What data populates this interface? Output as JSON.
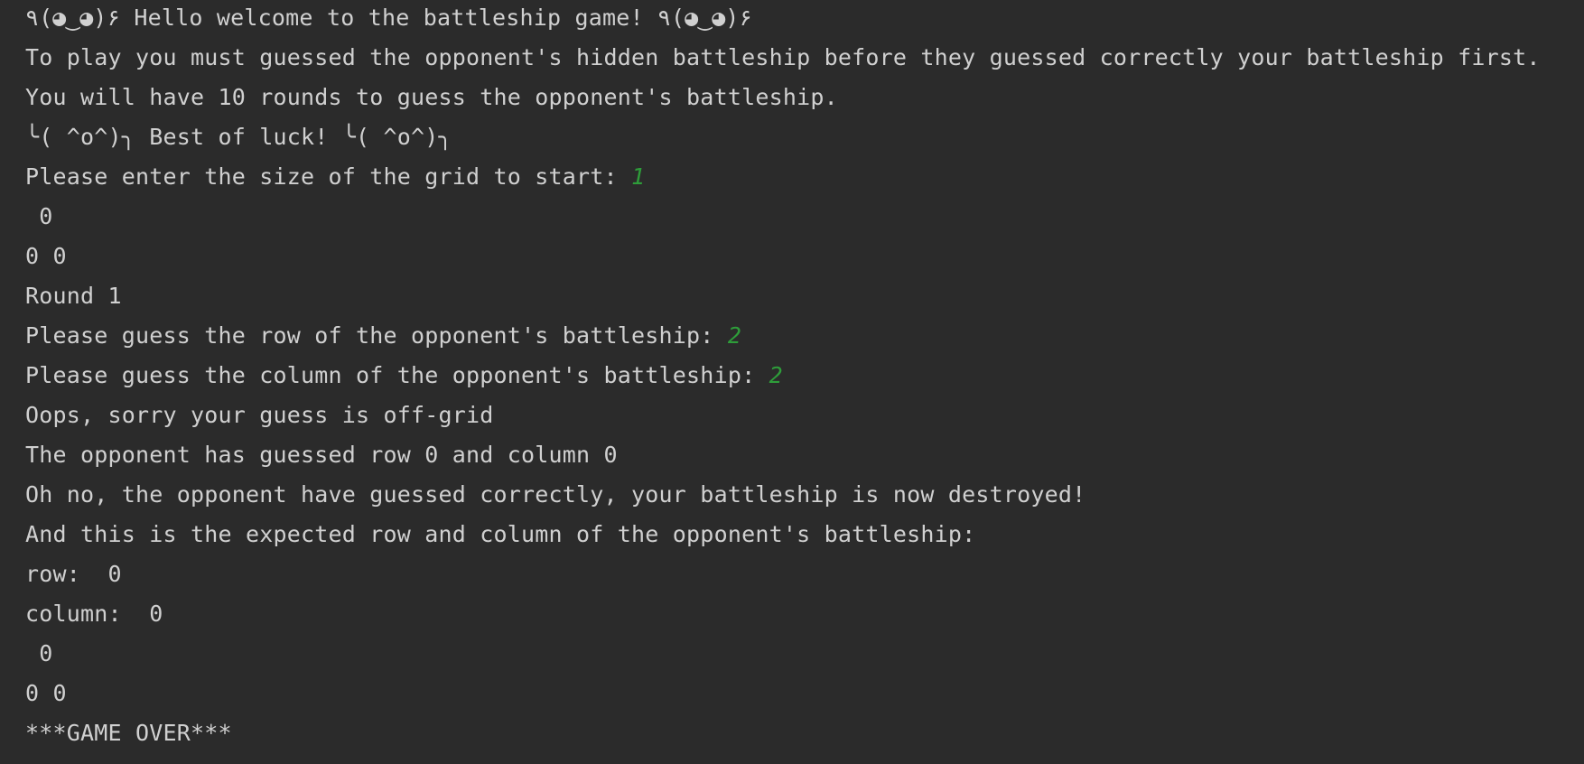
{
  "colors": {
    "background": "#2b2b2b",
    "text": "#d0d0d0",
    "user_input": "#2e9d3a"
  },
  "console": {
    "lines": [
      {
        "text": "٩(◕‿◕)۶ Hello welcome to the battleship game! ٩(◕‿◕)۶",
        "input": ""
      },
      {
        "text": "To play you must guessed the opponent's hidden battleship before they guessed correctly your battleship first.",
        "input": ""
      },
      {
        "text": "You will have 10 rounds to guess the opponent's battleship.",
        "input": ""
      },
      {
        "text": "╰( ^o^)╮ Best of luck! ╰( ^o^)╮",
        "input": ""
      },
      {
        "text": "Please enter the size of the grid to start: ",
        "input": "1"
      },
      {
        "text": " 0",
        "input": ""
      },
      {
        "text": "0 0",
        "input": ""
      },
      {
        "text": "Round 1",
        "input": ""
      },
      {
        "text": "Please guess the row of the opponent's battleship: ",
        "input": "2"
      },
      {
        "text": "Please guess the column of the opponent's battleship: ",
        "input": "2"
      },
      {
        "text": "Oops, sorry your guess is off-grid",
        "input": ""
      },
      {
        "text": "The opponent has guessed row 0 and column 0",
        "input": ""
      },
      {
        "text": "Oh no, the opponent have guessed correctly, your battleship is now destroyed!",
        "input": ""
      },
      {
        "text": "And this is the expected row and column of the opponent's battleship:",
        "input": ""
      },
      {
        "text": "row:  0",
        "input": ""
      },
      {
        "text": "column:  0",
        "input": ""
      },
      {
        "text": " 0",
        "input": ""
      },
      {
        "text": "0 0",
        "input": ""
      },
      {
        "text": "***GAME OVER***",
        "input": ""
      }
    ]
  }
}
